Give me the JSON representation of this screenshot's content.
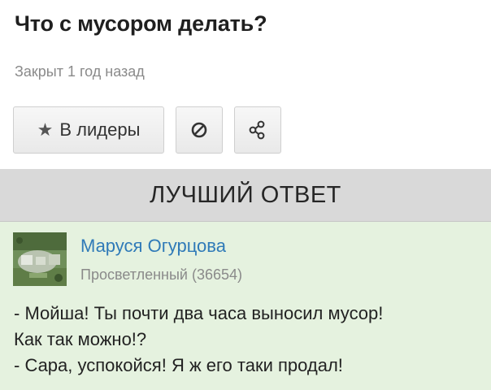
{
  "question": {
    "title": "Что с мусором делать?",
    "status": "Закрыт 1 год назад"
  },
  "actions": {
    "leaders_label": "В лидеры",
    "leaders_icon": "star-icon",
    "block_icon": "block-icon",
    "share_icon": "share-icon"
  },
  "best_answer": {
    "header": "ЛУЧШИЙ ОТВЕТ",
    "author_name": "Маруся Огурцова",
    "author_rank": "Просветленный (36654)",
    "lines": [
      "- Мойша! Ты почти два часа выносил мусор!",
      "Как так можно!?",
      "- Сара, успокойся! Я ж его таки продал!"
    ]
  },
  "colors": {
    "answer_bg": "#e5f2df",
    "header_bg": "#d9d9d9",
    "link": "#2f7ab8"
  }
}
